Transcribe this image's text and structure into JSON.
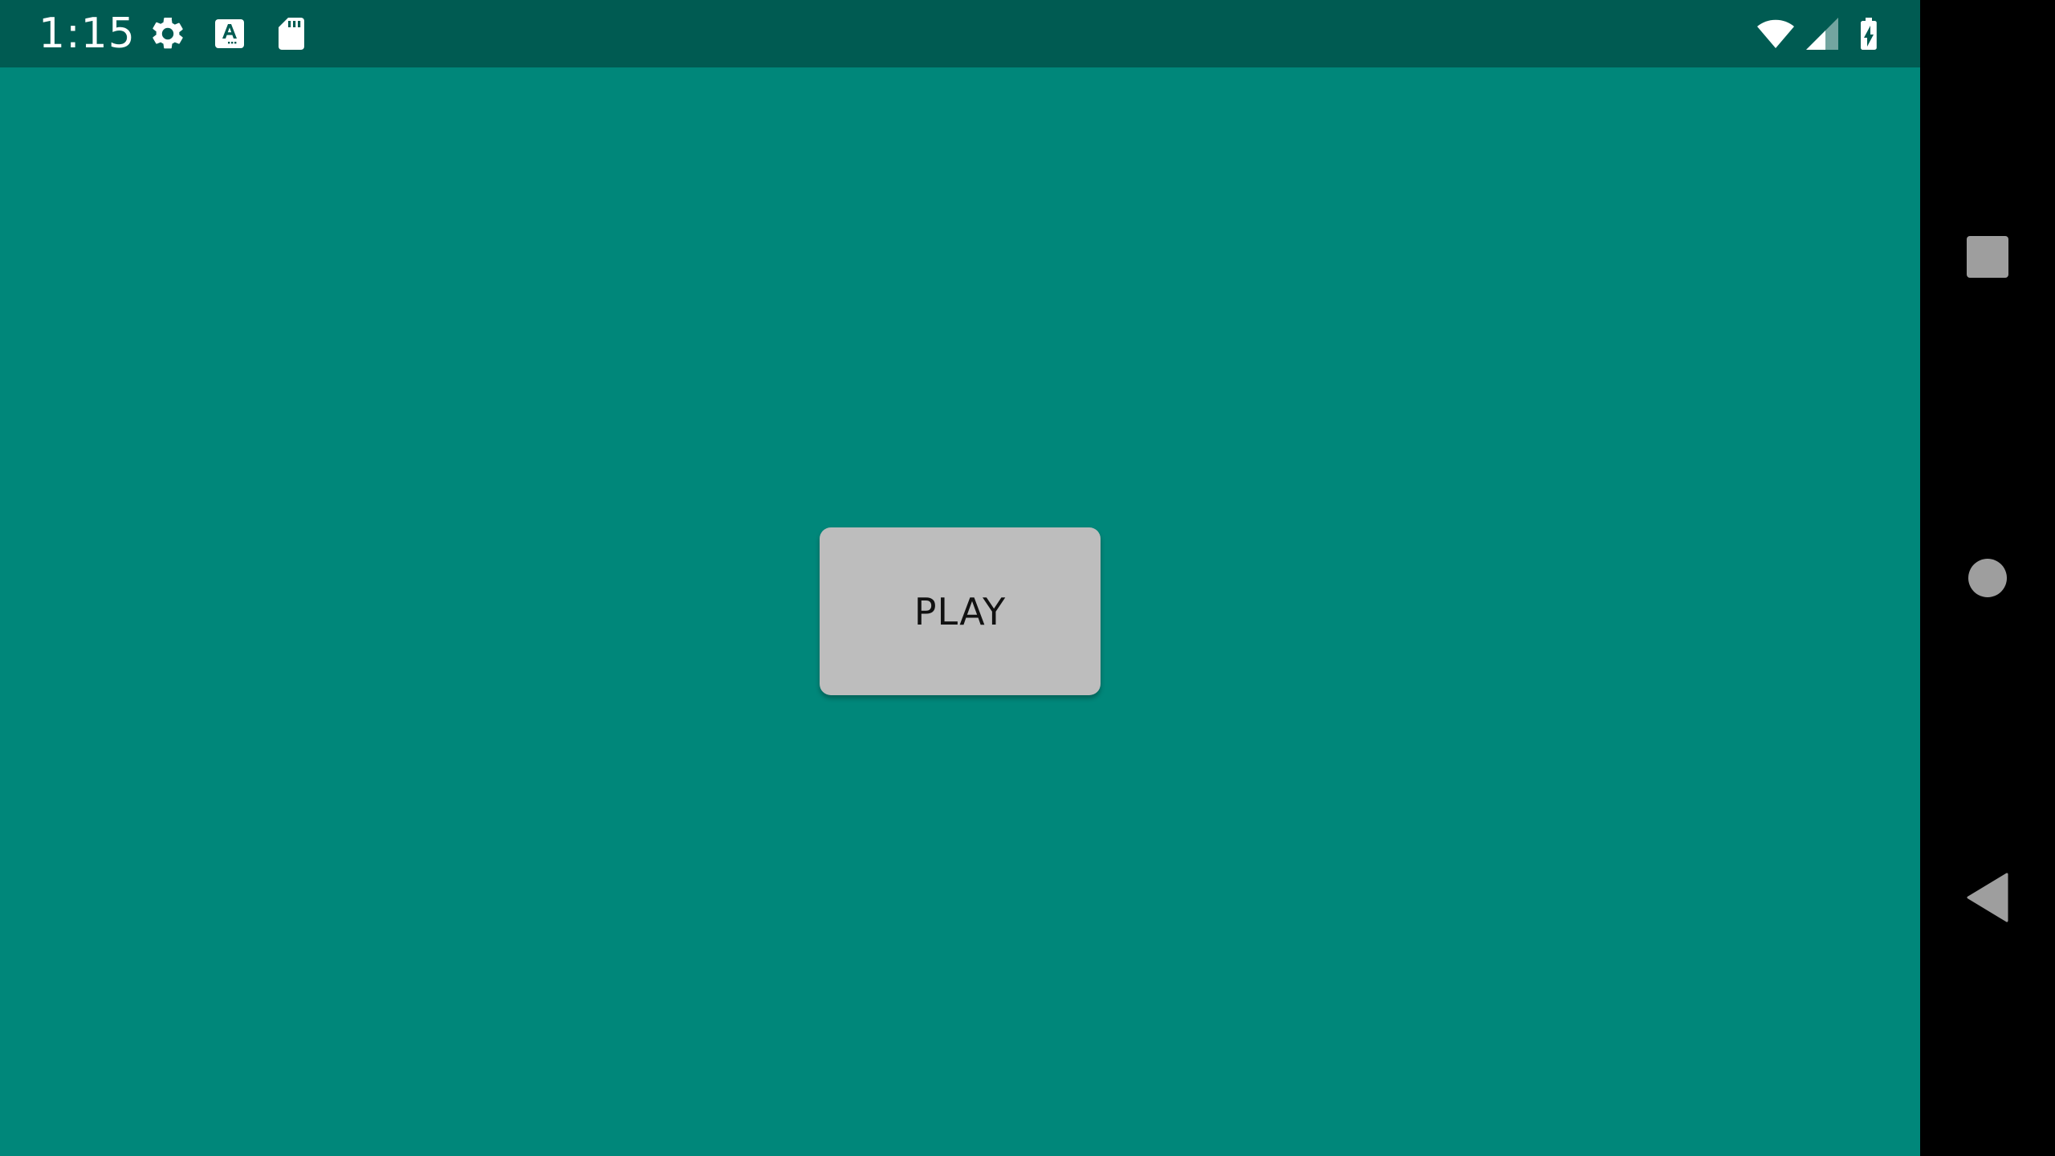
{
  "status_bar": {
    "time": "1:15",
    "left_icons": [
      "settings-icon",
      "font-a-icon",
      "sd-card-icon"
    ],
    "right_icons": [
      "wifi-icon",
      "cell-signal-icon",
      "battery-charging-icon"
    ]
  },
  "main": {
    "play_button_label": "PLAY"
  },
  "nav_bar": {
    "buttons": [
      "recents-button",
      "home-button",
      "back-button"
    ]
  },
  "colors": {
    "background": "#00877A",
    "status_bar": "#005B52",
    "button": "#BDBDBD",
    "nav_bar": "#000000",
    "nav_icon": "#9E9E9E"
  }
}
